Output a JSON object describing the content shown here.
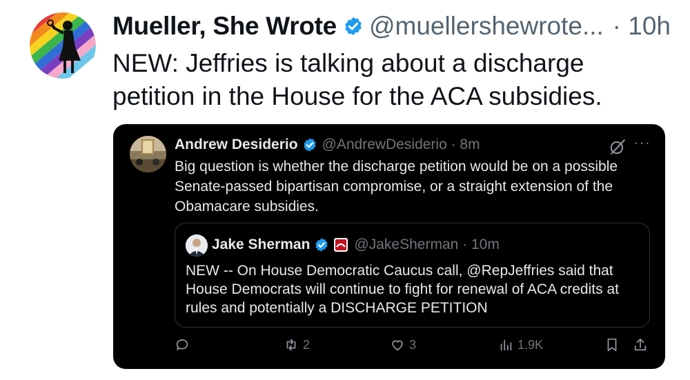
{
  "tweet": {
    "display_name": "Mueller, She Wrote",
    "handle": "@muellershewrote...",
    "separator": "·",
    "time": "10h",
    "text": "NEW: Jeffries is talking about a discharge petition in the House for the ACA subsidies."
  },
  "quoted": {
    "display_name": "Andrew Desiderio",
    "handle_time": "@AndrewDesiderio · 8m",
    "more": "···",
    "text": "Big question is whether the discharge petition would be on a possible Senate-passed bipartisan compromise, or a straight extension of the Obamacare subsidies.",
    "nested": {
      "display_name": "Jake Sherman",
      "handle_time": "@JakeSherman · 10m",
      "text": "NEW -- On House Democratic Caucus call, @RepJeffries said that House Democrats will continue to fight for renewal of ACA credits at rules and potentially a DISCHARGE PETITION"
    },
    "actions": {
      "reply_count": "",
      "repost_count": "2",
      "like_count": "3",
      "views_count": "1.9K"
    }
  },
  "colors": {
    "verified": "#1d9bf0",
    "card_bg": "#000000",
    "muted": "#71767b"
  }
}
